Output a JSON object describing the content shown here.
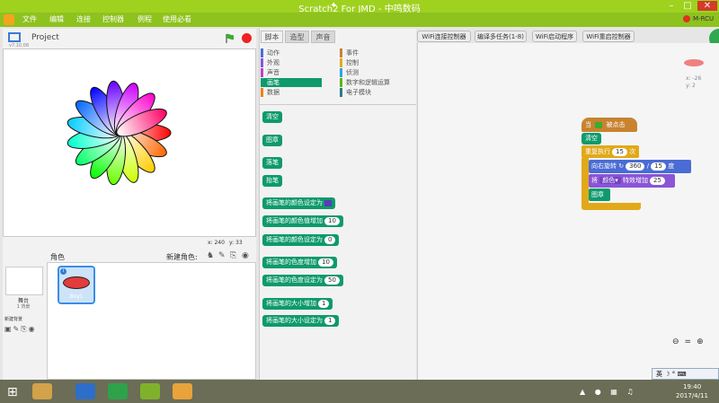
{
  "window": {
    "title": "Scratch2 For JMD - 中鸣数码"
  },
  "menu": {
    "file": "文件",
    "edit": "编辑",
    "connect": "连接",
    "controller": "控制器",
    "examples": "例程",
    "essentials": "使用必看"
  },
  "brand_tag": "M-RCU",
  "stage": {
    "project_label": "Project",
    "version": "v7.10.08",
    "x_label": "x: 240",
    "y_label": "y: 33"
  },
  "sprites": {
    "header": "角色",
    "new_sprite": "新建角色:",
    "backdrop_label": "舞台",
    "backdrop_count": "1 背景",
    "new_backdrop": "新建背景",
    "sprite1": "Boy1"
  },
  "tabs": {
    "scripts": "脚本",
    "costumes": "造型",
    "sounds": "声音"
  },
  "categories": [
    {
      "label": "动作",
      "color": "#4a6cd4"
    },
    {
      "label": "事件",
      "color": "#c88330"
    },
    {
      "label": "外观",
      "color": "#8a55d7"
    },
    {
      "label": "控制",
      "color": "#e1a91a"
    },
    {
      "label": "声音",
      "color": "#bb42c3"
    },
    {
      "label": "侦测",
      "color": "#2ca5e2"
    },
    {
      "label": "画笔",
      "color": "#0e9a6c"
    },
    {
      "label": "数字和逻辑运算",
      "color": "#5cb712"
    },
    {
      "label": "数据",
      "color": "#ee7d16"
    },
    {
      "label": "电子模块",
      "color": "#2c7b8c"
    }
  ],
  "blocks": {
    "clear": "清空",
    "stamp": "图章",
    "pen_down": "落笔",
    "pen_up": "抬笔",
    "set_color_to": "将画笔的颜色设定为",
    "change_color_by": "将画笔的颜色值增加",
    "change_color_val": "10",
    "set_color_val_to": "将画笔的颜色设定为",
    "set_color_val": "0",
    "change_shade_by": "将画笔的色度增加",
    "change_shade_val": "10",
    "set_shade_to": "将画笔的色度设定为",
    "set_shade_val": "50",
    "change_size_by": "将画笔的大小增加",
    "change_size_val": "1",
    "set_size_to": "将画笔的大小设定为",
    "set_size_val": "1"
  },
  "top_buttons": {
    "wifi_connect": "WiFi连接控制器",
    "compile": "编译多任务(1-8)",
    "wifi_start": "WiFi启动程序",
    "wifi_restart": "WiFi重启控制器"
  },
  "script": {
    "hat_when": "当",
    "hat_clicked": "被点击",
    "clear": "清空",
    "repeat": "重复执行",
    "repeat_count": "15",
    "repeat_unit": "次",
    "turn": "向右旋转",
    "turn_a": "360",
    "turn_div": "/",
    "turn_b": "15",
    "turn_unit": "度",
    "effect_prefix": "将",
    "effect_name": "颜色",
    "effect_mid": "特效增加",
    "effect_val": "25",
    "stamp": "图章"
  },
  "sprite_info": {
    "x": "x: -26",
    "y": "y: 2"
  },
  "tray": {
    "ime": "英",
    "time": "19:40",
    "date": "2017/4/11"
  }
}
